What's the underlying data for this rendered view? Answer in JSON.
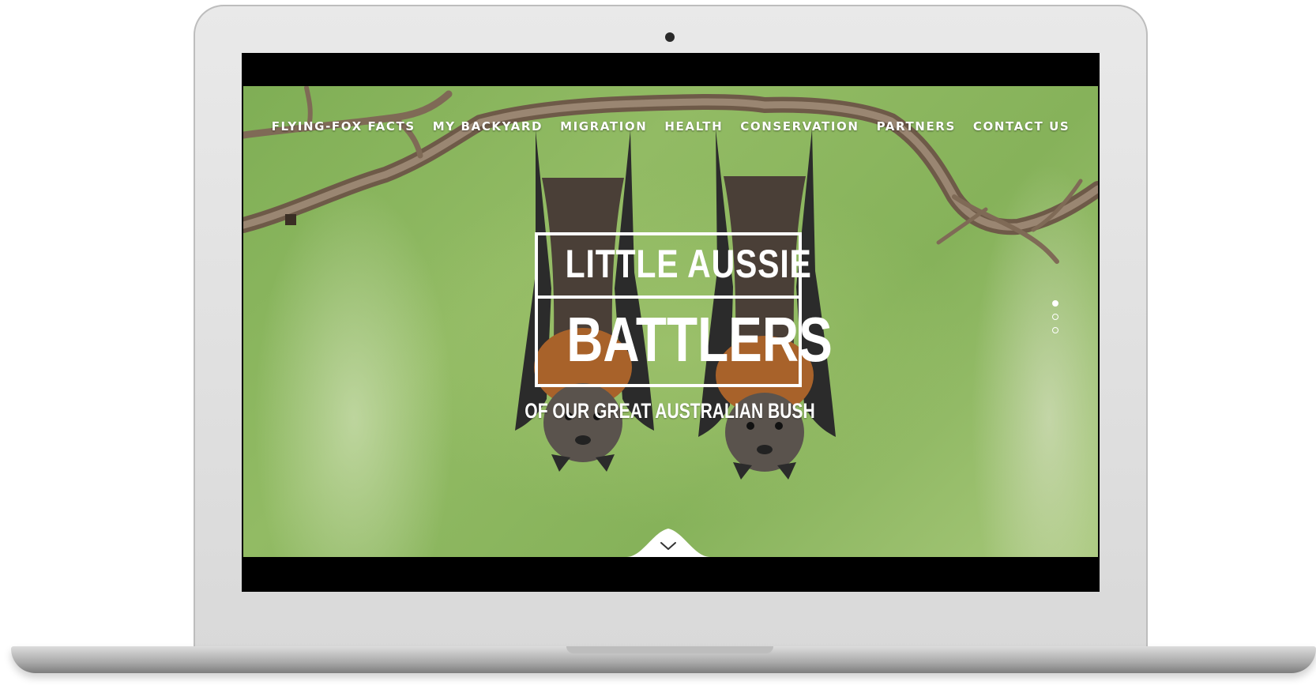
{
  "nav": {
    "items": [
      {
        "label": "FLYING-FOX FACTS"
      },
      {
        "label": "MY BACKYARD"
      },
      {
        "label": "MIGRATION"
      },
      {
        "label": "HEALTH"
      },
      {
        "label": "CONSERVATION"
      },
      {
        "label": "PARTNERS"
      },
      {
        "label": "CONTACT US"
      }
    ]
  },
  "hero": {
    "logo_line1": "LITTLE AUSSIE",
    "logo_line2": "BATTLERS",
    "tagline": "OF OUR GREAT AUSTRALIAN BUSH"
  },
  "slider": {
    "slide_count": 3,
    "active_index": 0
  },
  "icons": {
    "scroll_down": "chevron-down-icon",
    "camera": "camera-icon"
  },
  "colors": {
    "nav_text": "#ffffff",
    "logo": "#ffffff",
    "background_green": "#8fb862",
    "bezel": "#000000"
  }
}
